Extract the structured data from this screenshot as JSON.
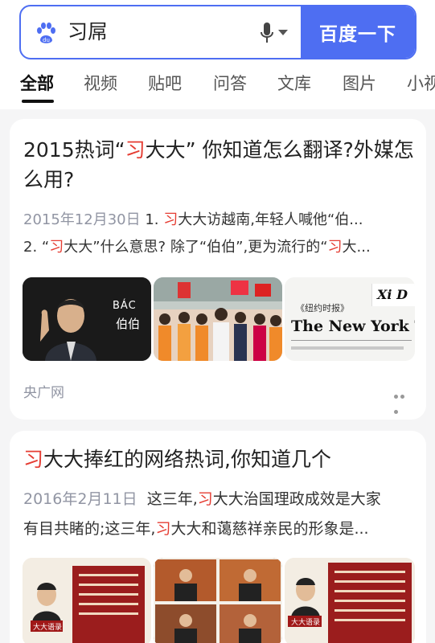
{
  "search": {
    "query": "习屌",
    "button_label": "百度一下"
  },
  "tabs": [
    "全部",
    "视频",
    "贴吧",
    "问答",
    "文库",
    "图片",
    "小视"
  ],
  "results": [
    {
      "title_prefix": "2015热词“",
      "title_hl": "习",
      "title_suffix": "大大” 你知道怎么翻译?外媒怎么用?",
      "line1_date": "2015年12月30日",
      "line1_a": "1. ",
      "line1_hl": "习",
      "line1_b": "大大访越南,年轻人喊他“伯...",
      "line2_a": "2. “",
      "line2_hl": "习",
      "line2_b": "大大”什么意思? 除了“伯伯”,更为流行的“",
      "line2_hl2": "习",
      "line2_c": "大...",
      "images": [
        {
          "icon": "xi-waving-photo",
          "caption_top": "BÁC",
          "caption_bottom": "伯伯"
        },
        {
          "icon": "crowd-students-photo"
        },
        {
          "icon": "nyt-masthead-photo",
          "header_text": "Xi D",
          "masthead": "The New York Tim",
          "small_text": "《纽约时报》"
        }
      ],
      "source": "央广网"
    },
    {
      "title_hl": "习",
      "title_suffix": "大大捧红的网络热词,你知道几个",
      "line1_date": "2016年2月11日",
      "line1_a": "这三年,",
      "line1_hl": "习",
      "line1_b": "大大治国理政成效是大家",
      "line2_a": "有目共睹的;这三年,",
      "line2_hl": "习",
      "line2_b": "大大和蔼慈祥亲民的形象是...",
      "images": [
        {
          "icon": "quote-card-image",
          "badge": "大大语录"
        },
        {
          "icon": "meeting-photos-grid"
        },
        {
          "icon": "quote-card-image",
          "badge": "大大语录"
        }
      ]
    }
  ],
  "colors": {
    "accent": "#4e6ef2",
    "highlight": "#e53d33"
  }
}
